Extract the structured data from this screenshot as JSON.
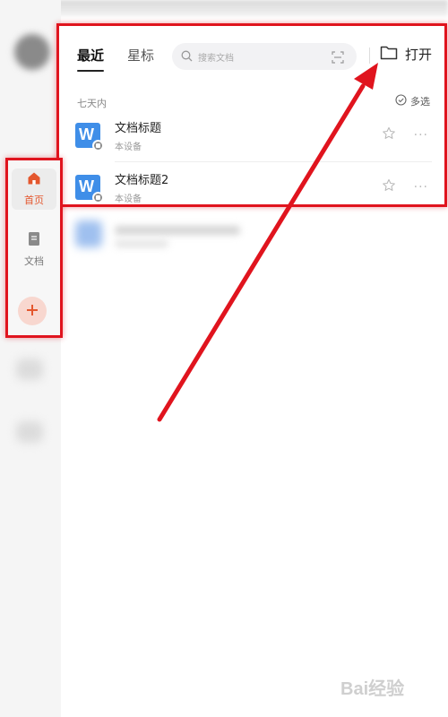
{
  "header": {
    "tabs": [
      {
        "label": "最近",
        "active": true
      },
      {
        "label": "星标",
        "active": false
      }
    ],
    "search_placeholder": "搜索文档",
    "open_label": "打开"
  },
  "recent": {
    "section_label": "七天内",
    "multi_select_label": "多选",
    "files": [
      {
        "title": "文档标题",
        "location": "本设备",
        "icon": "word-doc-icon"
      },
      {
        "title": "文档标题2",
        "location": "本设备",
        "icon": "word-doc-icon"
      }
    ]
  },
  "sidebar": {
    "items": [
      {
        "label": "首页",
        "icon": "home-icon",
        "active": true
      },
      {
        "label": "文档",
        "icon": "document-icon",
        "active": false
      }
    ],
    "add_icon": "plus-icon"
  },
  "watermark": "Bai经验",
  "colors": {
    "highlight": "#e0141e",
    "accent": "#e4572e",
    "doc_blue": "#3f8ee8"
  }
}
